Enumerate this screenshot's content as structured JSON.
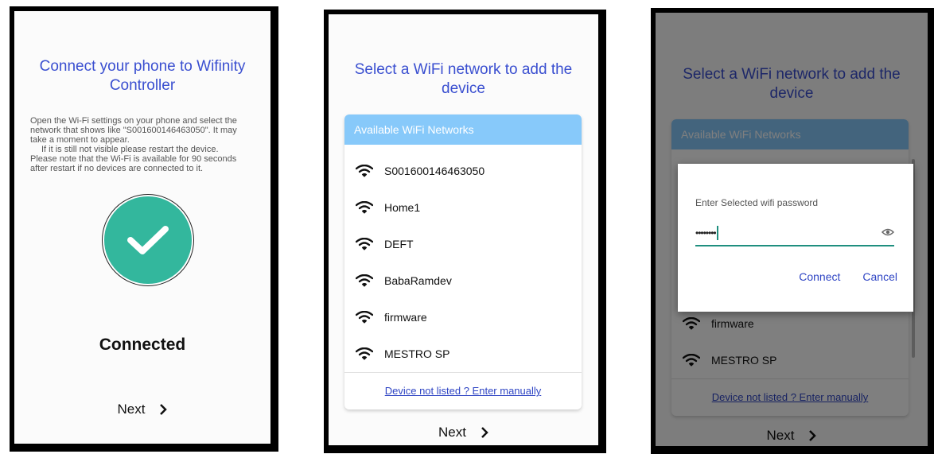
{
  "screen1": {
    "title": "Connect your phone to Wifinity Controller",
    "instructions_1": "Open the Wi-Fi settings on your phone and select the network that shows like \"S001600146463050\". It may take a moment to appear.",
    "instructions_2": "If it is still not visible please restart the device.",
    "instructions_3": "Please note that the Wi-Fi is available for 90 seconds after restart if no devices are connected to it.",
    "status": "Connected",
    "next_label": "Next",
    "next_icon": "chevron-right-icon",
    "status_icon": "check-circle-icon",
    "accent_color": "#33b79d"
  },
  "screen2": {
    "title": "Select a WiFi network to add the device",
    "list_header": "Available WiFi Networks",
    "networks": [
      "S001600146463050",
      "Home1",
      "DEFT",
      "BabaRamdev",
      "firmware",
      "MESTRO SP"
    ],
    "manual_link": "Device not listed ? Enter manually",
    "next_label": "Next",
    "header_color": "#87c9fa",
    "network_icon": "wifi-icon"
  },
  "screen3": {
    "title": "Select a WiFi network to add the device",
    "list_header": "Available WiFi Networks",
    "networks_visible": [
      "firmware",
      "MESTRO SP"
    ],
    "manual_link": "Device not listed ? Enter manually",
    "next_label": "Next",
    "dialog": {
      "label": "Enter Selected wifi password",
      "password_value": "••••••••",
      "connect_label": "Connect",
      "cancel_label": "Cancel",
      "visibility_icon": "eye-icon",
      "underline_color": "#1f8f7f"
    }
  }
}
